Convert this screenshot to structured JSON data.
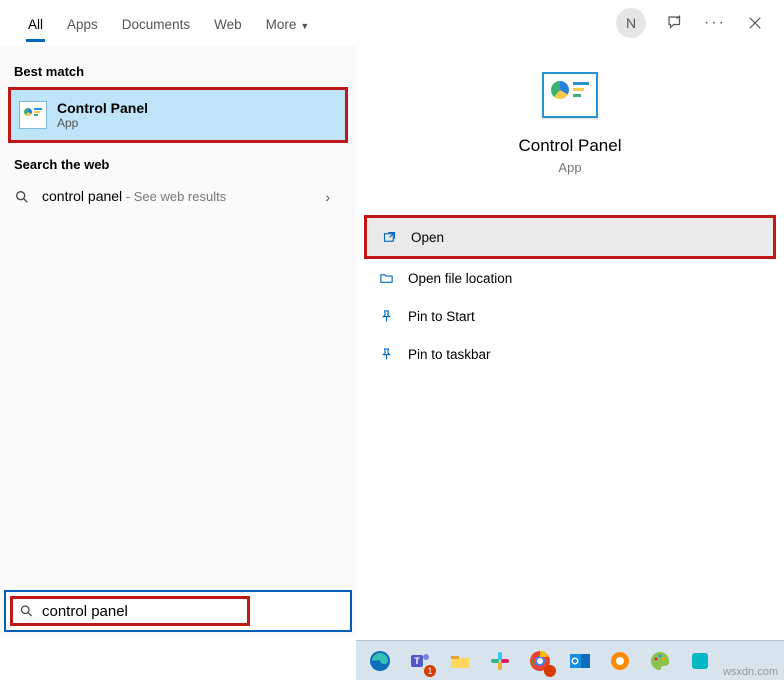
{
  "tabs": {
    "all": "All",
    "apps": "Apps",
    "documents": "Documents",
    "web": "Web",
    "more": "More"
  },
  "avatar_initial": "N",
  "sections": {
    "best_match": "Best match",
    "search_web": "Search the web"
  },
  "best_match": {
    "title": "Control Panel",
    "subtitle": "App"
  },
  "web_result": {
    "query": "control panel",
    "suffix": " - See web results"
  },
  "detail": {
    "title": "Control Panel",
    "subtitle": "App"
  },
  "actions": {
    "open": "Open",
    "open_location": "Open file location",
    "pin_start": "Pin to Start",
    "pin_taskbar": "Pin to taskbar"
  },
  "search": {
    "value": "control panel"
  },
  "watermark": "wsxdn.com"
}
